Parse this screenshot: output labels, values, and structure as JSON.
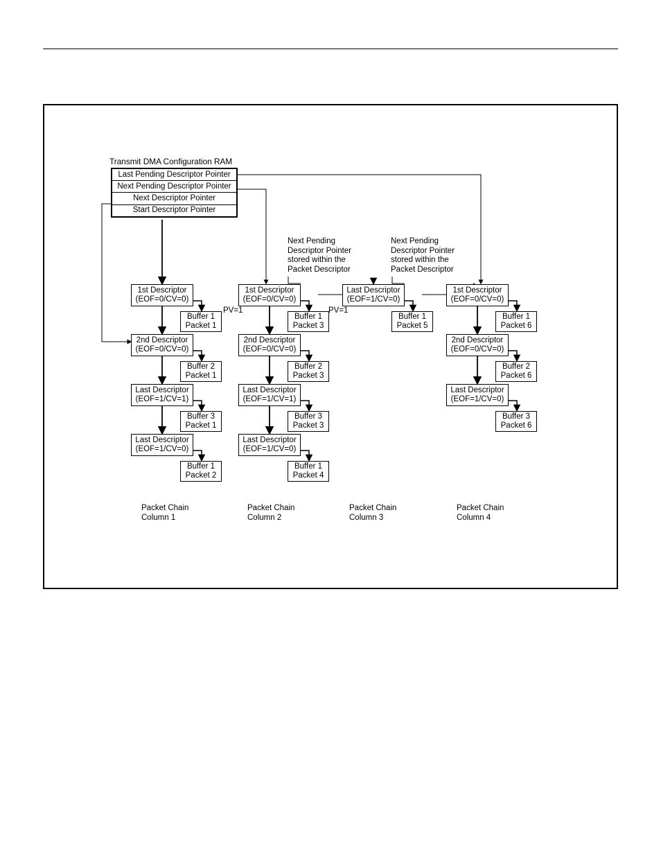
{
  "ram": {
    "title": "Transmit DMA Configuration RAM",
    "rows": [
      "Last Pending Descriptor Pointer",
      "Next Pending Descriptor Pointer",
      "Next Descriptor Pointer",
      "Start Descriptor Pointer"
    ]
  },
  "pendingNote": {
    "l1": "Next Pending",
    "l2": "Descriptor Pointer",
    "l3": "stored within the",
    "l4": "Packet Descriptor"
  },
  "pv": "PV=1",
  "columns": [
    {
      "caption_l1": "Packet Chain",
      "caption_l2": "Column 1",
      "descs": [
        {
          "l1": "1st Descriptor",
          "l2": "(EOF=0/CV=0)",
          "buf1": "Buffer 1",
          "buf2": "Packet 1"
        },
        {
          "l1": "2nd Descriptor",
          "l2": "(EOF=0/CV=0)",
          "buf1": "Buffer 2",
          "buf2": "Packet 1"
        },
        {
          "l1": "Last Descriptor",
          "l2": "(EOF=1/CV=1)",
          "buf1": "Buffer 3",
          "buf2": "Packet 1"
        },
        {
          "l1": "Last Descriptor",
          "l2": "(EOF=1/CV=0)",
          "buf1": "Buffer 1",
          "buf2": "Packet 2"
        }
      ]
    },
    {
      "caption_l1": "Packet Chain",
      "caption_l2": "Column 2",
      "descs": [
        {
          "l1": "1st Descriptor",
          "l2": "(EOF=0/CV=0)",
          "buf1": "Buffer 1",
          "buf2": "Packet 3"
        },
        {
          "l1": "2nd Descriptor",
          "l2": "(EOF=0/CV=0)",
          "buf1": "Buffer 2",
          "buf2": "Packet 3"
        },
        {
          "l1": "Last Descriptor",
          "l2": "(EOF=1/CV=1)",
          "buf1": "Buffer 3",
          "buf2": "Packet 3"
        },
        {
          "l1": "Last Descriptor",
          "l2": "(EOF=1/CV=0)",
          "buf1": "Buffer 1",
          "buf2": "Packet 4"
        }
      ]
    },
    {
      "caption_l1": "Packet Chain",
      "caption_l2": "Column 3",
      "descs": [
        {
          "l1": "Last Descriptor",
          "l2": "(EOF=1/CV=0)",
          "buf1": "Buffer 1",
          "buf2": "Packet 5"
        }
      ]
    },
    {
      "caption_l1": "Packet Chain",
      "caption_l2": "Column 4",
      "descs": [
        {
          "l1": "1st Descriptor",
          "l2": "(EOF=0/CV=0)",
          "buf1": "Buffer 1",
          "buf2": "Packet 6"
        },
        {
          "l1": "2nd Descriptor",
          "l2": "(EOF=0/CV=0)",
          "buf1": "Buffer 2",
          "buf2": "Packet 6"
        },
        {
          "l1": "Last Descriptor",
          "l2": "(EOF=1/CV=0)",
          "buf1": "Buffer 3",
          "buf2": "Packet 6"
        }
      ]
    }
  ]
}
